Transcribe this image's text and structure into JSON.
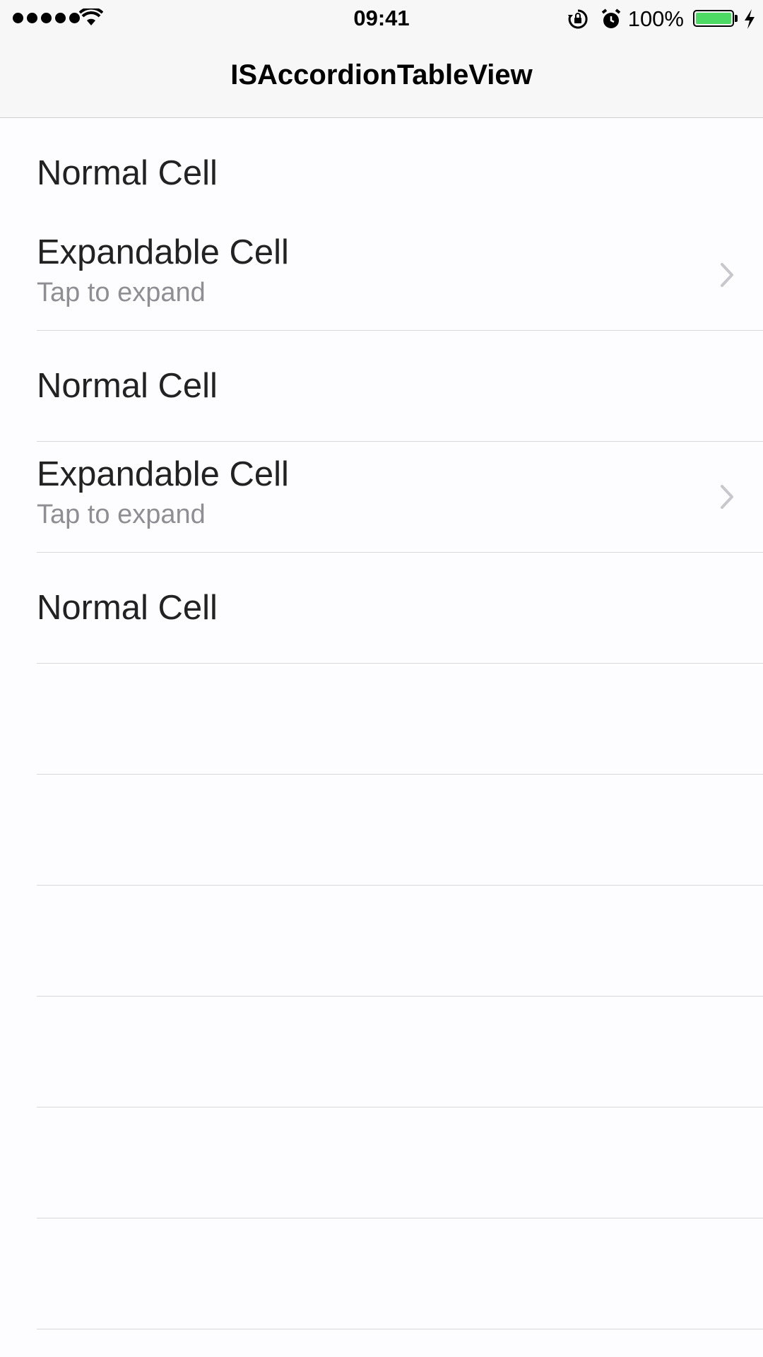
{
  "status_bar": {
    "time": "09:41",
    "battery_percent": "100%",
    "battery_level": 1.0,
    "battery_color": "#4cd964",
    "icons": [
      "signal-dots-icon",
      "wifi-icon",
      "rotation-lock-icon",
      "alarm-icon",
      "battery-icon",
      "charging-bolt-icon"
    ]
  },
  "nav": {
    "title": "ISAccordionTableView"
  },
  "table": {
    "cells": [
      {
        "type": "normal",
        "title": "Normal Cell"
      },
      {
        "type": "expandable",
        "title": "Expandable Cell",
        "subtitle": "Tap to expand",
        "accessory": "chevron-right-icon"
      },
      {
        "type": "normal",
        "title": "Normal Cell"
      },
      {
        "type": "expandable",
        "title": "Expandable Cell",
        "subtitle": "Tap to expand",
        "accessory": "chevron-right-icon"
      },
      {
        "type": "normal",
        "title": "Normal Cell"
      }
    ]
  },
  "colors": {
    "background": "#fdfdff",
    "bar_background": "#f7f7f7",
    "separator": "#d8d8dc",
    "subtitle": "#8e8e93"
  }
}
